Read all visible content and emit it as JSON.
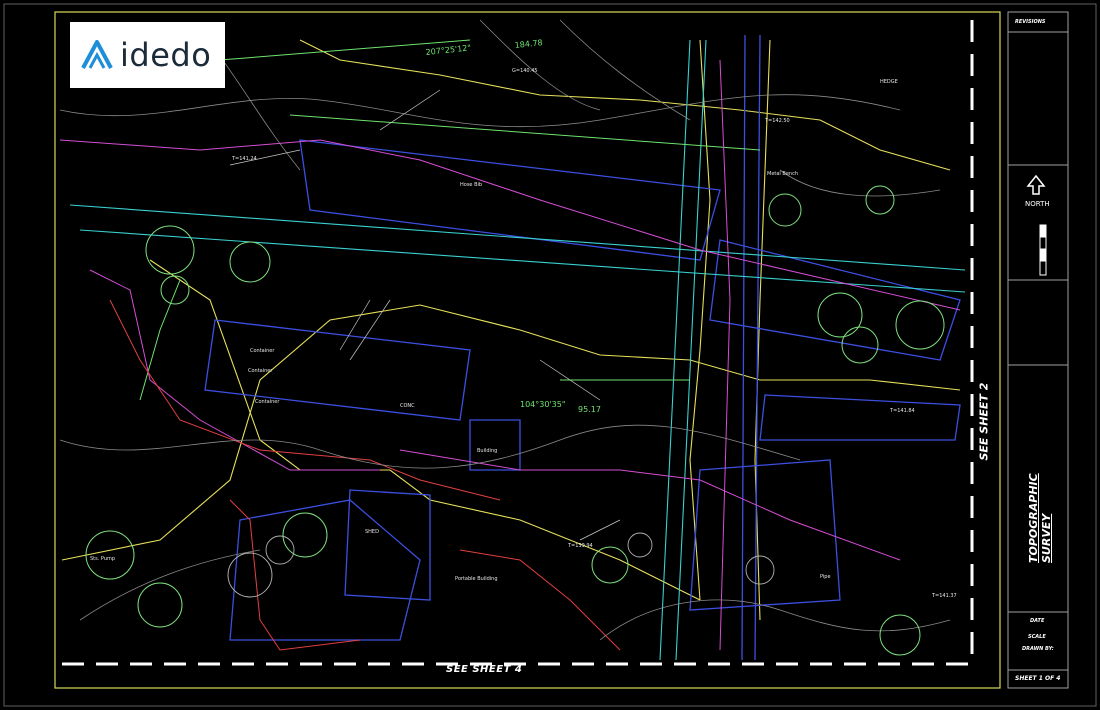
{
  "logo": {
    "text": "idedo"
  },
  "sheet": {
    "title": "TOPOGRAPHIC SURVEY",
    "match_bottom": "SEE SHEET 4",
    "match_right": "SEE SHEET 2",
    "north_label": "NORTH",
    "sheet_no": "SHEET 1 OF 4",
    "date_label": "DATE",
    "scale_label": "SCALE",
    "drawn_label": "DRAWN BY:",
    "revisions": "REVISIONS"
  },
  "labels": {
    "bearing_top": "207°25'12\"",
    "dist_top": "184.78",
    "bearing_mid": "104°30'35\"",
    "dist_mid": "95.17",
    "bldg_a": "Container",
    "bldg_b": "Container",
    "bldg_c": "Container",
    "shed": "SHED",
    "portable": "Portable Building",
    "building": "Building",
    "metal_bench": "Metal Bench",
    "hedge": "HEDGE",
    "sts_pump": "Sts. Pump",
    "elev_a": "T=141.24",
    "elev_b": "T=139.94",
    "elev_c": "T=141.84",
    "elev_d": "T=141.37",
    "elev_e": "T=142.50",
    "elev_f": "G=140.45",
    "hose": "Hose Bib",
    "pipe": "Pipe",
    "conc": "CONC"
  }
}
